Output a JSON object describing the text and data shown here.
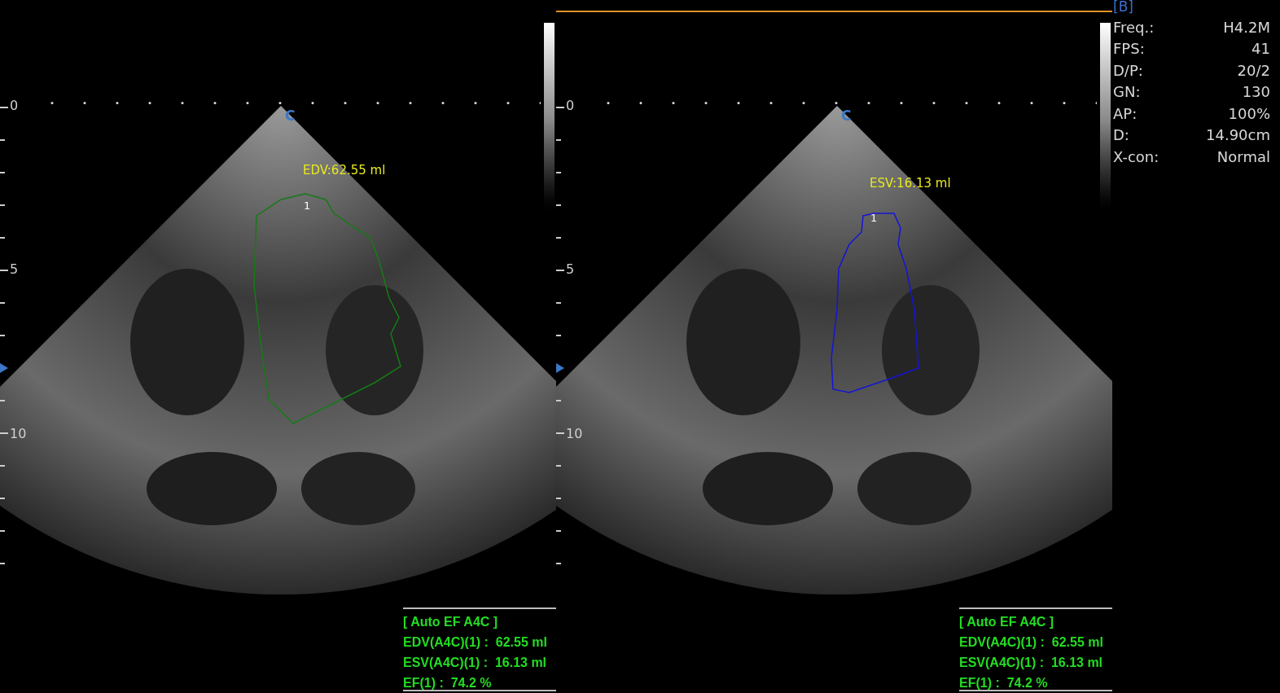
{
  "panes": [
    {
      "depth_labels": [
        "0",
        "5",
        "10"
      ],
      "probe_mark": "C",
      "measurement_label": "EDV:62.55 ml",
      "contour_number": "1",
      "results": {
        "title": "[ Auto EF A4C ]",
        "lines": [
          "EDV(A4C)(1) :  62.55 ml",
          "ESV(A4C)(1) :  16.13 ml",
          "EF(1) :  74.2 %"
        ]
      },
      "active": false
    },
    {
      "depth_labels": [
        "0",
        "5",
        "10"
      ],
      "probe_mark": "C",
      "measurement_label": "ESV:16.13 ml",
      "contour_number": "1",
      "results": {
        "title": "[ Auto EF A4C ]",
        "lines": [
          "EDV(A4C)(1) :  62.55 ml",
          "ESV(A4C)(1) :  16.13 ml",
          "EF(1) :  74.2 %"
        ]
      },
      "active": true
    }
  ],
  "mode": "[B]",
  "parameters": [
    {
      "label": "Freq.:",
      "value": "H4.2M"
    },
    {
      "label": "FPS:",
      "value": "41"
    },
    {
      "label": "D/P:",
      "value": "20/2"
    },
    {
      "label": "GN:",
      "value": "130"
    },
    {
      "label": "AP:",
      "value": "100%"
    },
    {
      "label": "D:",
      "value": "14.90cm"
    },
    {
      "label": "X-con:",
      "value": "Normal"
    }
  ]
}
